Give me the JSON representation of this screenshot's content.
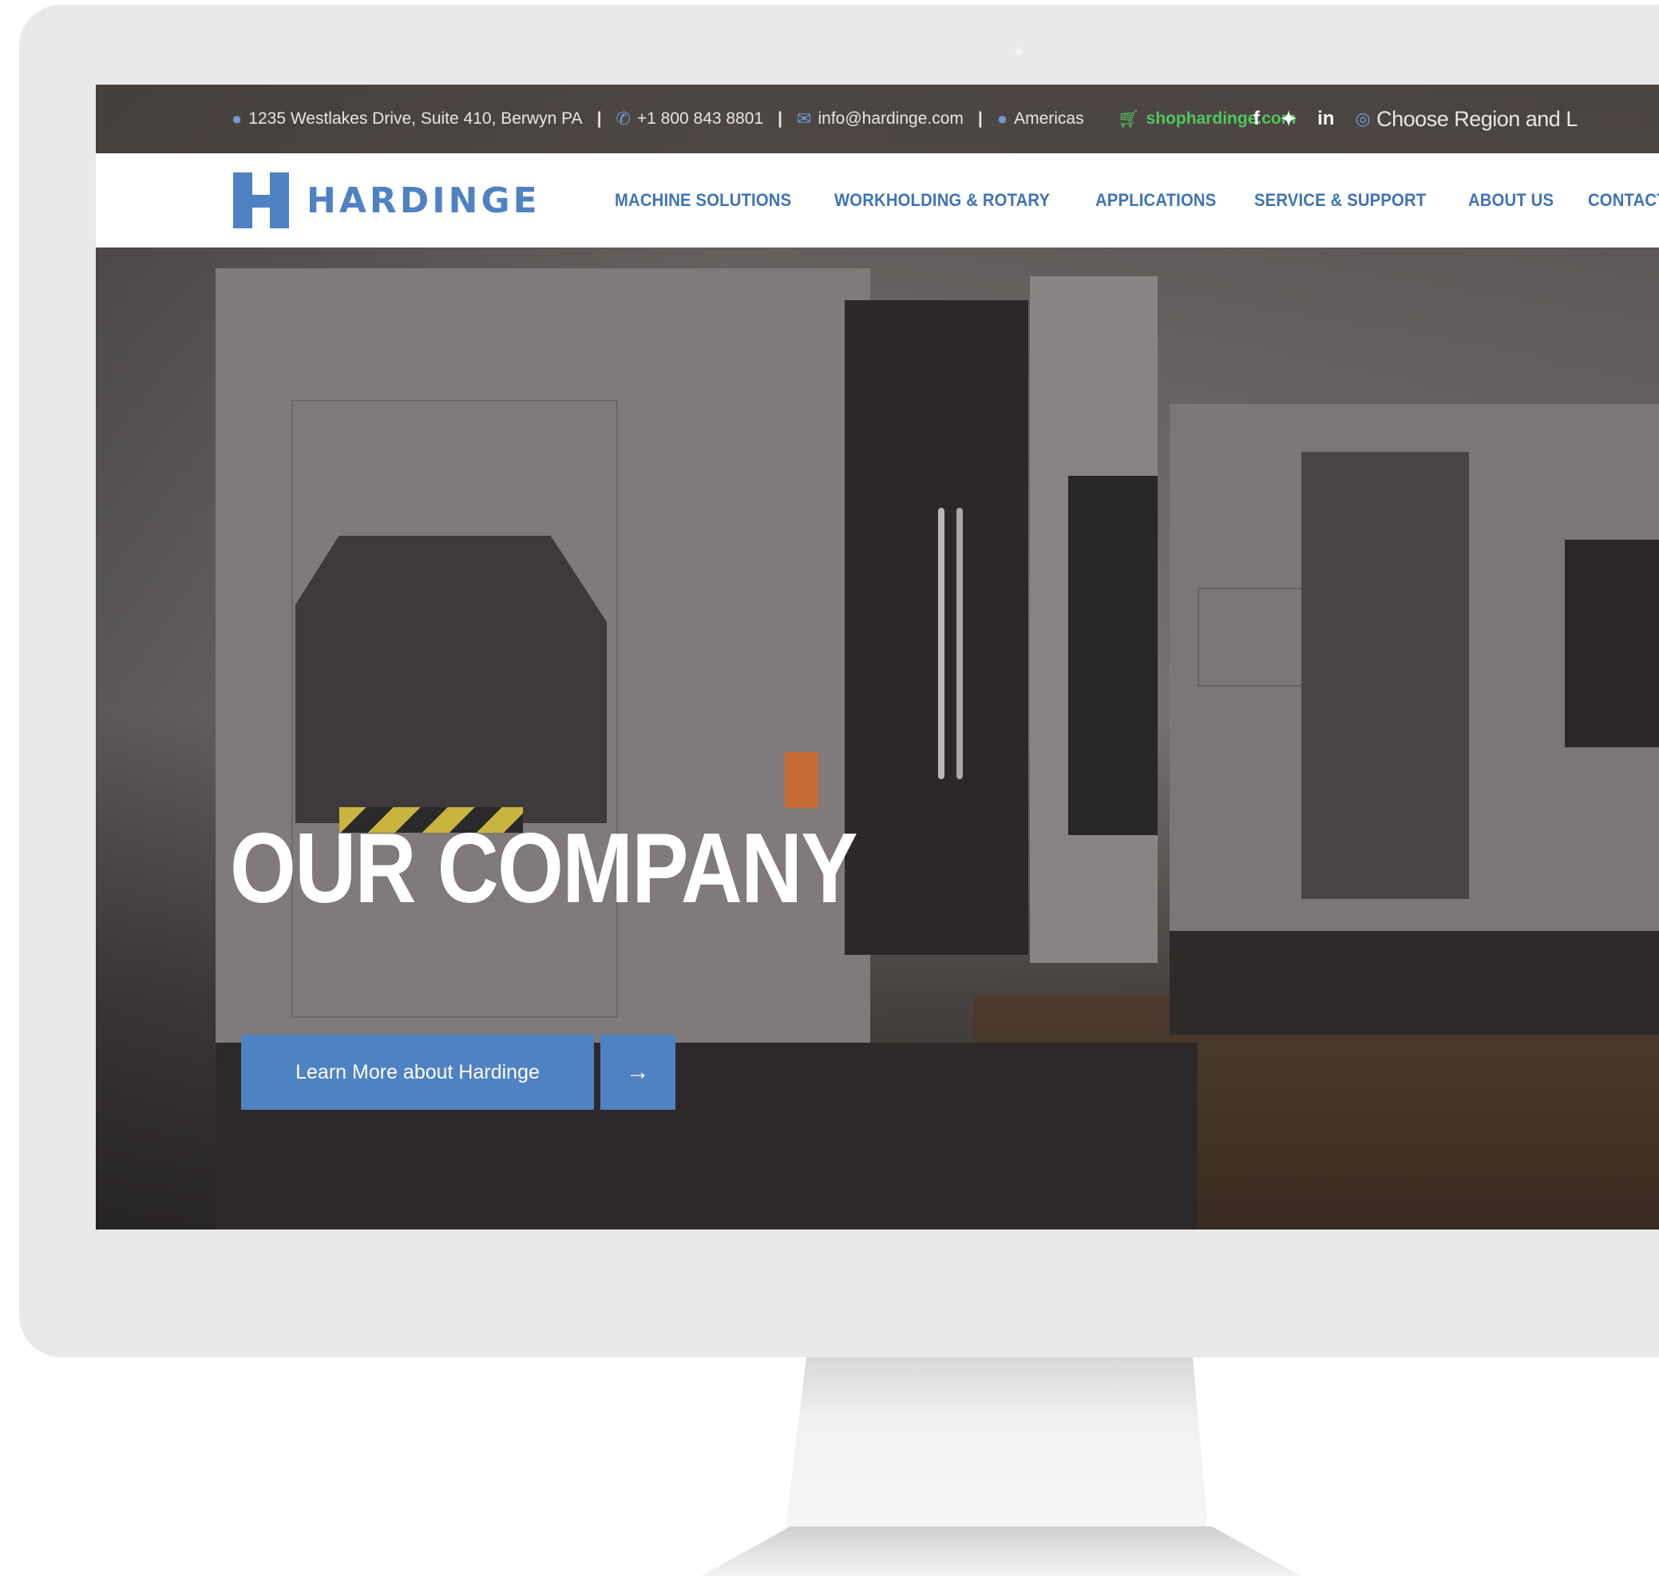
{
  "topbar": {
    "address": "1235 Westlakes Drive, Suite 410, Berwyn PA",
    "phone": "+1 800 843 8801",
    "email": "info@hardinge.com",
    "region": "Americas",
    "shop_link": "shophardinge.com",
    "separator": "|",
    "region_selector": "Choose Region and L",
    "icons": {
      "location": "map-pin-icon",
      "phone": "phone-icon",
      "email": "envelope-icon",
      "region": "map-pin-icon",
      "cart": "cart-icon",
      "facebook": "facebook-icon",
      "twitter": "twitter-icon",
      "linkedin": "linkedin-icon",
      "globe": "globe-icon"
    },
    "linkedin_label": "in"
  },
  "brand": {
    "name": "HARDINGE",
    "color": "#4f82c2"
  },
  "nav": {
    "items": [
      {
        "label": "MACHINE SOLUTIONS"
      },
      {
        "label": "WORKHOLDING & ROTARY"
      },
      {
        "label": "APPLICATIONS"
      },
      {
        "label": "SERVICE & SUPPORT"
      },
      {
        "label": "ABOUT US"
      },
      {
        "label": "CONTACT"
      }
    ],
    "color": "#3f74b6"
  },
  "hero": {
    "title": "OUR COMPANY",
    "cta_label": "Learn More about Hardinge",
    "cta_arrow": "→"
  },
  "colors": {
    "accent": "#4f82c2",
    "shop_link": "#4ec95e"
  }
}
